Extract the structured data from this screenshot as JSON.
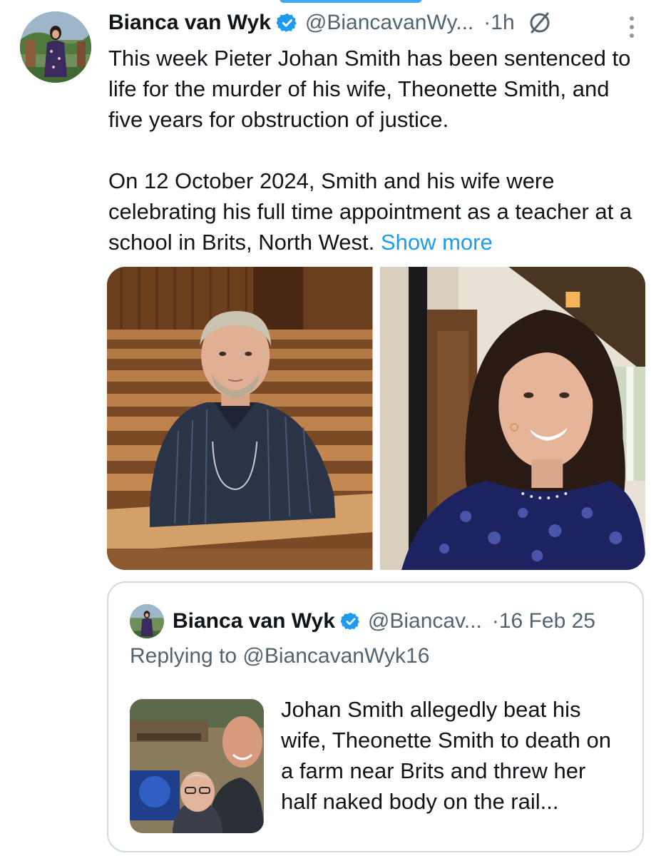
{
  "tweet": {
    "author_name": "Bianca van Wyk",
    "handle": "@BiancavanWy...",
    "time": "·1h",
    "paragraph1": "This week Pieter Johan Smith has been sentenced to life for the murder of his wife, Theonette Smith, and five years for obstruction of justice.",
    "paragraph2": "On 12 October 2024, Smith and his wife were celebrating his full time appointment as a  teacher at a school in Brits, North West.",
    "show_more": "Show more",
    "icons": [
      "verified-badge-icon",
      "grok-icon",
      "more-vertical-icon"
    ]
  },
  "quote": {
    "author_name": "Bianca van Wyk",
    "handle": "@Biancav...",
    "time": "·16 Feb 25",
    "replying": "Replying to @BiancavanWyk16",
    "text": "Johan Smith allegedly beat his wife, Theonette Smith to death on a farm  near Brits and threw her half naked body on the rail..."
  },
  "colors": {
    "accent": "#1d9bf0",
    "text": "#0f1419",
    "secondary": "#536471",
    "border": "#cfd9de"
  }
}
